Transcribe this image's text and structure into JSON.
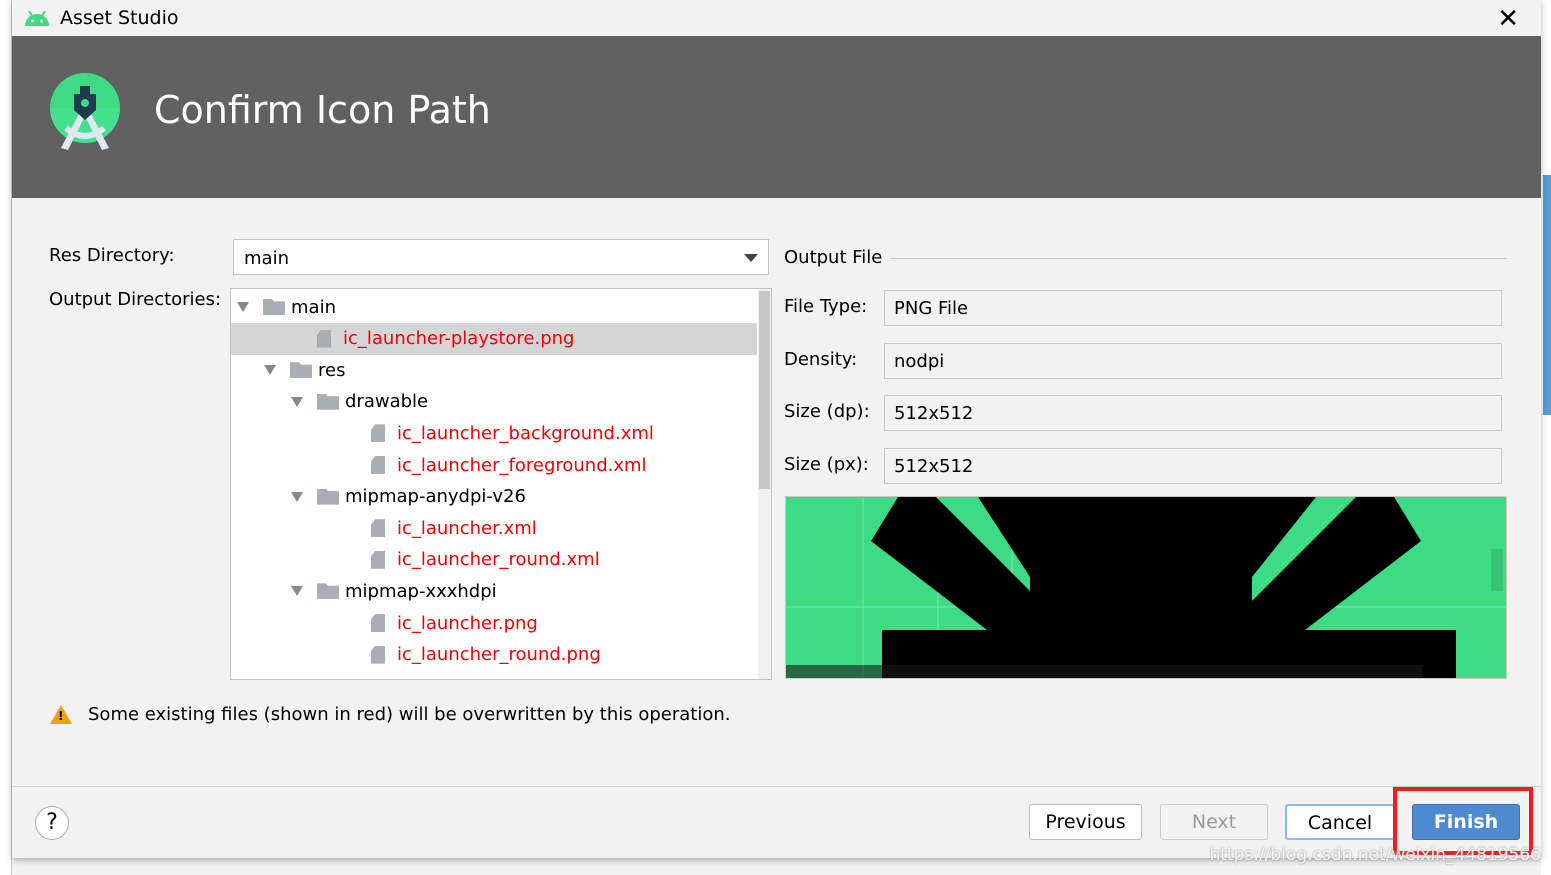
{
  "window": {
    "title": "Asset Studio",
    "close_icon": "close-icon"
  },
  "header": {
    "title": "Confirm Icon Path"
  },
  "res_directory": {
    "label": "Res Directory:",
    "value": "main"
  },
  "output_directories": {
    "label": "Output Directories:",
    "items": [
      {
        "label": "main",
        "type": "folder",
        "depth": 0,
        "overwrite": false
      },
      {
        "label": "ic_launcher-playstore.png",
        "type": "file",
        "depth": 1,
        "overwrite": true,
        "selected": true
      },
      {
        "label": "res",
        "type": "folder",
        "depth": 1,
        "overwrite": false
      },
      {
        "label": "drawable",
        "type": "folder",
        "depth": 2,
        "overwrite": false
      },
      {
        "label": "ic_launcher_background.xml",
        "type": "file",
        "depth": 3,
        "overwrite": true
      },
      {
        "label": "ic_launcher_foreground.xml",
        "type": "file",
        "depth": 3,
        "overwrite": true
      },
      {
        "label": "mipmap-anydpi-v26",
        "type": "folder",
        "depth": 2,
        "overwrite": false
      },
      {
        "label": "ic_launcher.xml",
        "type": "file",
        "depth": 3,
        "overwrite": true
      },
      {
        "label": "ic_launcher_round.xml",
        "type": "file",
        "depth": 3,
        "overwrite": true
      },
      {
        "label": "mipmap-xxxhdpi",
        "type": "folder",
        "depth": 2,
        "overwrite": false
      },
      {
        "label": "ic_launcher.png",
        "type": "file",
        "depth": 3,
        "overwrite": true
      },
      {
        "label": "ic_launcher_round.png",
        "type": "file",
        "depth": 3,
        "overwrite": true
      }
    ]
  },
  "output_file": {
    "title": "Output File",
    "file_type": {
      "label": "File Type:",
      "value": "PNG File"
    },
    "density": {
      "label": "Density:",
      "value": "nodpi"
    },
    "size_dp": {
      "label": "Size (dp):",
      "value": "512x512"
    },
    "size_px": {
      "label": "Size (px):",
      "value": "512x512"
    }
  },
  "warning": {
    "text": "Some existing files (shown in red) will be overwritten by this operation."
  },
  "buttons": {
    "previous": "Previous",
    "next": "Next",
    "cancel": "Cancel",
    "finish": "Finish",
    "help": "?"
  },
  "colors": {
    "header": "#616161",
    "accent": "#4d8ad0",
    "overwrite": "#ee0000",
    "preview_bg": "#3ddc84",
    "highlight": "#f01e1e"
  },
  "watermark": "https://blog.csdn.net/weixin_44819566"
}
